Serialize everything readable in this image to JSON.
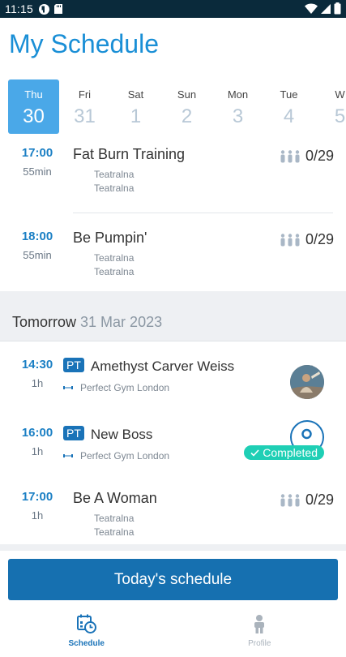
{
  "status_bar": {
    "time": "11:15"
  },
  "page_title": "My Schedule",
  "days": [
    {
      "name": "Thu",
      "num": "30",
      "active": true
    },
    {
      "name": "Fri",
      "num": "31"
    },
    {
      "name": "Sat",
      "num": "1"
    },
    {
      "name": "Sun",
      "num": "2"
    },
    {
      "name": "Mon",
      "num": "3"
    },
    {
      "name": "Tue",
      "num": "4"
    },
    {
      "name": "W",
      "num": "5"
    }
  ],
  "today_classes": [
    {
      "time": "17:00",
      "duration": "55min",
      "name": "Fat Burn Training",
      "loc1": "Teatralna",
      "loc2": "Teatralna",
      "capacity": "0/29"
    },
    {
      "time": "18:00",
      "duration": "55min",
      "name": "Be Pumpin'",
      "loc1": "Teatralna",
      "loc2": "Teatralna",
      "capacity": "0/29"
    }
  ],
  "tomorrow": {
    "label": "Tomorrow",
    "date": "31 Mar 2023",
    "items": [
      {
        "time": "14:30",
        "duration": "1h",
        "badge": "PT",
        "name": "Amethyst Carver Weiss",
        "gym": "Perfect Gym London"
      },
      {
        "time": "16:00",
        "duration": "1h",
        "badge": "PT",
        "name": "New Boss",
        "gym": "Perfect Gym London",
        "status": "Completed"
      },
      {
        "time": "17:00",
        "duration": "1h",
        "name": "Be A Woman",
        "loc1": "Teatralna",
        "loc2": "Teatralna",
        "capacity": "0/29"
      }
    ]
  },
  "today_button": "Today's schedule",
  "tabs": [
    {
      "label": "Schedule",
      "icon": "calendar-clock-icon",
      "active": true
    },
    {
      "label": "Profile",
      "icon": "person-icon"
    }
  ],
  "colors": {
    "accent": "#1a8fd6",
    "button": "#1670b0",
    "completed": "#1fcfb5"
  }
}
